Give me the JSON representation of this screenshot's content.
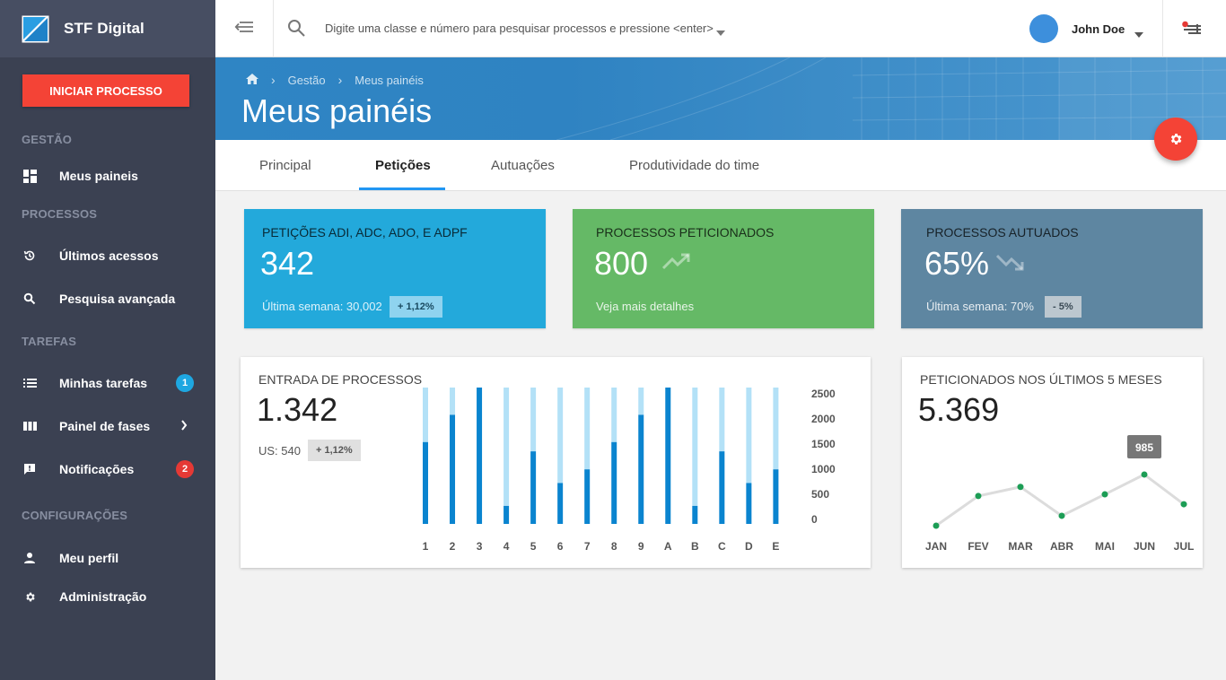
{
  "app": {
    "name": "STF Digital",
    "start_button": "INICIAR PROCESSO"
  },
  "sidebar": {
    "sections": [
      {
        "label": "GESTÃO"
      },
      {
        "label": "PROCESSOS"
      },
      {
        "label": "TAREFAS"
      },
      {
        "label": "CONFIGURAÇÕES"
      }
    ],
    "items": [
      {
        "label": "Meus paineis",
        "icon": "dashboard-icon"
      },
      {
        "label": "Últimos acessos",
        "icon": "history-icon"
      },
      {
        "label": "Pesquisa avançada",
        "icon": "search-icon"
      },
      {
        "label": "Minhas tarefas",
        "icon": "list-icon",
        "badge": "1",
        "badge_color": "#1ea7e1"
      },
      {
        "label": "Painel de fases",
        "icon": "columns-icon"
      },
      {
        "label": "Notificações",
        "icon": "feedback-icon",
        "badge": "2",
        "badge_color": "#e53935"
      },
      {
        "label": "Meu perfil",
        "icon": "person-icon"
      },
      {
        "label": "Administração",
        "icon": "gear-icon"
      }
    ]
  },
  "topbar": {
    "search_placeholder": "Digite uma classe e número para pesquisar processos e pressione <enter>",
    "user_name": "John Doe"
  },
  "hero": {
    "breadcrumb": [
      "Gestão",
      "Meus painéis"
    ],
    "title": "Meus painéis"
  },
  "tabs": [
    {
      "label": "Principal"
    },
    {
      "label": "Petições",
      "active": true
    },
    {
      "label": "Autuações"
    },
    {
      "label": "Produtividade do time"
    }
  ],
  "stats": [
    {
      "title": "PETIÇÕES ADI, ADC, ADO, e ADPF",
      "value": "342",
      "footer": "Última semana: 30,002",
      "chip": "+ 1,12%",
      "color": "#23a9db"
    },
    {
      "title": "PROCESSOS PETICIONADOS",
      "value": "800",
      "footer": "Veja mais detalhes",
      "trend": "up",
      "color": "#65b966"
    },
    {
      "title": "PROCESSOS AUTUADOS",
      "value": "65%",
      "footer": "Última semana: 70%",
      "chip": "- 5%",
      "trend": "down",
      "color": "#5e86a1"
    }
  ],
  "entrada": {
    "title": "ENTRADA DE PROCESSOS",
    "value": "1.342",
    "sub": "US: 540",
    "chip": "+ 1,12%"
  },
  "peticionados": {
    "title": "PETICIONADOS  NOS ÚLTIMOS 5 MESES",
    "value": "5.369",
    "tooltip": "985"
  },
  "chart_data": [
    {
      "type": "bar",
      "categories": [
        "1",
        "2",
        "3",
        "4",
        "5",
        "6",
        "7",
        "8",
        "9",
        "A",
        "B",
        "C",
        "D",
        "E"
      ],
      "series": [
        {
          "values": [
            1500,
            2000,
            2500,
            330,
            1330,
            750,
            1000,
            1500,
            2000,
            2500,
            330,
            1330,
            750,
            1000
          ]
        },
        {
          "values": [
            1000,
            500,
            0,
            2170,
            1170,
            1750,
            1500,
            1000,
            500,
            0,
            2170,
            1170,
            1750,
            1500
          ]
        }
      ],
      "stacked": true,
      "ylim": [
        0,
        2500
      ],
      "yticks": [
        "2500",
        "2000",
        "1500",
        "1000",
        "500",
        "0"
      ],
      "colors": [
        "#0a84cf",
        "#b3e1f7"
      ]
    },
    {
      "type": "line",
      "x": [
        "JAN",
        "FEV",
        "MAR",
        "ABR",
        "MAI",
        "JUN",
        "JUL"
      ],
      "values": [
        0,
        36,
        47,
        12,
        38,
        62,
        26
      ],
      "ylim": [
        0,
        100
      ],
      "highlight": {
        "index": 5,
        "label": "985"
      },
      "colors": [
        "#1c9d55",
        "#dcdcdc"
      ]
    }
  ]
}
